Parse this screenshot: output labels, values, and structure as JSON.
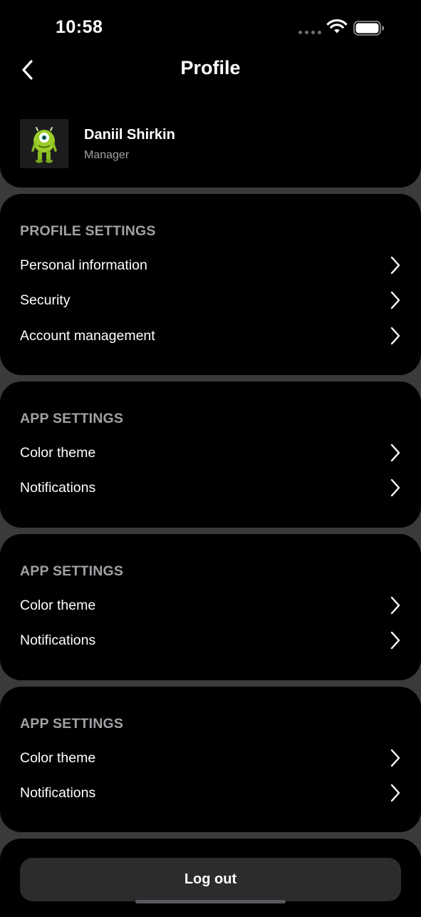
{
  "status_bar": {
    "time": "10:58"
  },
  "nav": {
    "title": "Profile",
    "back_icon": "chevron-left-icon"
  },
  "profile": {
    "name": "Daniil Shirkin",
    "role": "Manager"
  },
  "sections": [
    {
      "title": "PROFILE SETTINGS",
      "items": [
        {
          "label": "Personal information"
        },
        {
          "label": "Security"
        },
        {
          "label": "Account management"
        }
      ]
    },
    {
      "title": "APP SETTINGS",
      "items": [
        {
          "label": "Color theme"
        },
        {
          "label": "Notifications"
        }
      ]
    },
    {
      "title": "APP SETTINGS",
      "items": [
        {
          "label": "Color theme"
        },
        {
          "label": "Notifications"
        }
      ]
    },
    {
      "title": "APP SETTINGS",
      "items": [
        {
          "label": "Color theme"
        },
        {
          "label": "Notifications"
        }
      ]
    }
  ],
  "logout": {
    "label": "Log out"
  },
  "colors": {
    "background": "#3a3a3c",
    "card": "#000000",
    "section_title": "#a1a1a6",
    "button": "#2c2c2e",
    "avatar_green": "#9ccc2a"
  }
}
